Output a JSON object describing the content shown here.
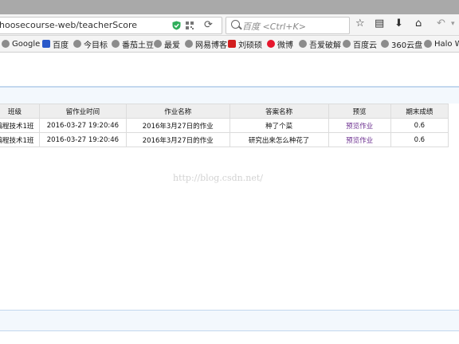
{
  "browser": {
    "url": "hoosecourse-web/teacherScore",
    "search_placeholder": "百度 <Ctrl+K>",
    "icons": [
      "shield-check-icon",
      "qr-code-icon",
      "reload-icon",
      "star-icon",
      "reading-list-icon",
      "download-icon",
      "home-icon",
      "undo-icon",
      "chevron-down-icon"
    ]
  },
  "bookmarks": [
    {
      "label": "Google"
    },
    {
      "label": "百度"
    },
    {
      "label": "今目标"
    },
    {
      "label": "番茄土豆"
    },
    {
      "label": "最爱"
    },
    {
      "label": "网易博客"
    },
    {
      "label": "刘硕硕"
    },
    {
      "label": "微博"
    },
    {
      "label": "吾爱破解"
    },
    {
      "label": "百度云"
    },
    {
      "label": "360云盘"
    },
    {
      "label": "Halo W"
    }
  ],
  "table": {
    "headers": [
      "班级",
      "留作业时间",
      "作业名称",
      "答案名称",
      "预览",
      "期末成绩"
    ],
    "rows": [
      {
        "class": "编程技术1班",
        "time": "2016-03-27 19:20:46",
        "homework": "2016年3月27日的作业",
        "answer": "种了个菜",
        "preview": "预览作业",
        "score": "0.6"
      },
      {
        "class": "编程技术1班",
        "time": "2016-03-27 19:20:46",
        "homework": "2016年3月27日的作业",
        "answer": "研究出来怎么种花了",
        "preview": "预览作业",
        "score": "0.6"
      }
    ]
  },
  "watermark": "http://blog.csdn.net/",
  "colors": {
    "link": "#6b2e8f",
    "accent_rule": "#c3d7ee",
    "band": "#f3f8fd"
  }
}
